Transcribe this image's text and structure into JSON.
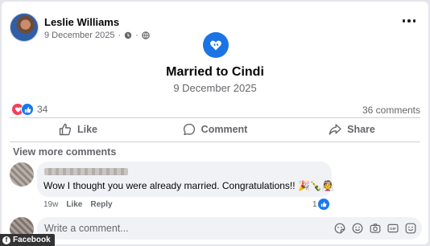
{
  "post": {
    "author": "Leslie Williams",
    "date": "9 December 2025",
    "separator": "·"
  },
  "event": {
    "title": "Married to Cindi",
    "date": "9 December 2025"
  },
  "stats": {
    "reaction_count": "34",
    "comments": "36 comments"
  },
  "actions": {
    "like": "Like",
    "comment": "Comment",
    "share": "Share"
  },
  "comments": {
    "view_more": "View more comments",
    "items": [
      {
        "text": "Wow I thought you were already married. Congratulations!! 🎉🍾👰",
        "time": "19w",
        "like": "Like",
        "reply": "Reply",
        "reactions": "1"
      }
    ]
  },
  "composer": {
    "placeholder": "Write a comment..."
  },
  "watermark": "Facebook",
  "icons": {
    "audience": "globe-icon",
    "event": "hearts-icon",
    "love": "heart-reaction-icon",
    "like": "thumbs-up-icon"
  },
  "colors": {
    "accent": "#1877f2",
    "love": "#f33e58",
    "secondary_text": "#65676b"
  }
}
